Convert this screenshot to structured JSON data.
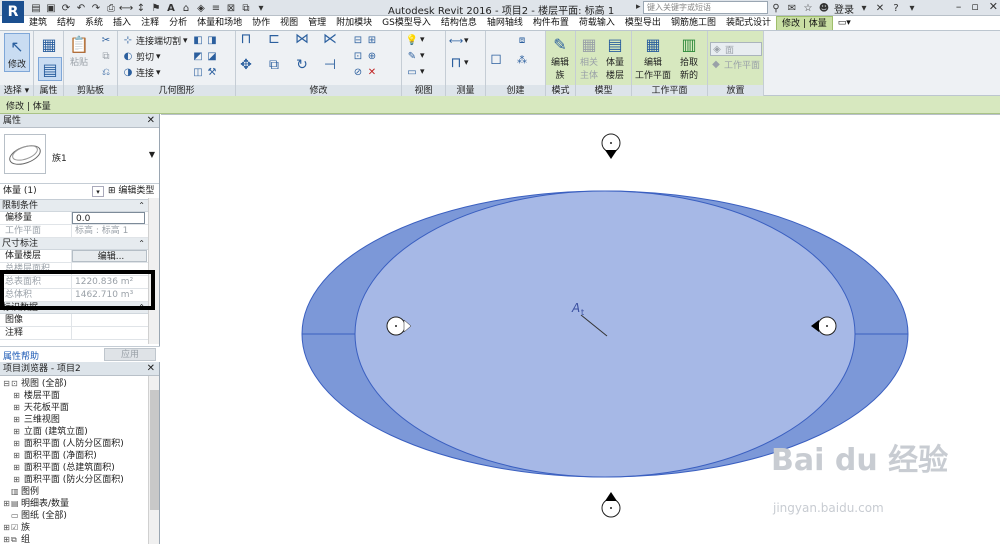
{
  "window": {
    "logo": "R",
    "title": "Autodesk Revit 2016 -     项目2 - 楼层平面: 标高 1",
    "search_placeholder": "键入关键字或短语",
    "login": "登录"
  },
  "ribbon": {
    "tabs": [
      "建筑",
      "结构",
      "系统",
      "插入",
      "注释",
      "分析",
      "体量和场地",
      "协作",
      "视图",
      "管理",
      "附加模块",
      "GS模型导入",
      "结构信息",
      "轴网轴线",
      "构件布置",
      "荷载输入",
      "模型导出",
      "钢筋施工图",
      "装配式设计",
      "修改 | 体量"
    ],
    "active_tab": "修改 | 体量",
    "panels": {
      "select": "选择",
      "properties": "属性",
      "clipboard": "剪贴板",
      "geometry": "几何图形",
      "modify": "修改",
      "view": "视图",
      "measure": "测量",
      "create": "创建",
      "mode": "模式",
      "model": "模型",
      "workplane": "工作平面",
      "placement": "放置"
    },
    "buttons": {
      "modify": "修改",
      "paste": "粘贴",
      "join_cut": "连接端切割",
      "cut": "剪切",
      "join": "连接",
      "edit_family": "编辑\n族",
      "in_place_body": "相关\n主体",
      "mass_floors": "体量\n楼层",
      "edit_workplane": "编辑\n工作平面",
      "pick_new": "拾取\n新的",
      "face": "面",
      "workplane": "工作平面"
    }
  },
  "context_bar": {
    "label": "修改 | 体量"
  },
  "properties": {
    "title": "属性",
    "type_name": "族1",
    "instance_label": "体量 (1)",
    "edit_type": "编辑类型",
    "groups": {
      "constraints": "限制条件",
      "dimensions": "尺寸标注",
      "identity": "标识数据"
    },
    "rows": {
      "offset_key": "偏移量",
      "offset_val": "0.0",
      "workplane_key": "工作平面",
      "workplane_val": "标高 : 标高 1",
      "mass_floors_key": "体量楼层",
      "mass_floors_val": "编辑...",
      "total_floor_area_key": "总楼层面积",
      "total_surface_key": "总表面积",
      "total_surface_val": "1220.836 m²",
      "total_volume_key": "总体积",
      "total_volume_val": "1462.710 m³",
      "image_key": "图像",
      "comments_key": "注释"
    },
    "help": "属性帮助",
    "apply": "应用"
  },
  "browser": {
    "title": "项目浏览器 - 项目2",
    "items": [
      {
        "label": "视图 (全部)",
        "level": 0,
        "exp": "⊟"
      },
      {
        "label": "楼层平面",
        "level": 1,
        "exp": "⊞"
      },
      {
        "label": "天花板平面",
        "level": 1,
        "exp": "⊞"
      },
      {
        "label": "三维视图",
        "level": 1,
        "exp": "⊞"
      },
      {
        "label": "立面 (建筑立面)",
        "level": 1,
        "exp": "⊞"
      },
      {
        "label": "面积平面 (人防分区面积)",
        "level": 1,
        "exp": "⊞"
      },
      {
        "label": "面积平面 (净面积)",
        "level": 1,
        "exp": "⊞"
      },
      {
        "label": "面积平面 (总建筑面积)",
        "level": 1,
        "exp": "⊞"
      },
      {
        "label": "面积平面 (防火分区面积)",
        "level": 1,
        "exp": "⊞"
      },
      {
        "label": "图例",
        "level": 0,
        "exp": ""
      },
      {
        "label": "明细表/数量",
        "level": 0,
        "exp": "⊞"
      },
      {
        "label": "图纸 (全部)",
        "level": 0,
        "exp": ""
      },
      {
        "label": "族",
        "level": 0,
        "exp": "⊞"
      },
      {
        "label": "组",
        "level": 0,
        "exp": "⊞"
      }
    ]
  },
  "colors": {
    "mass_outer": "#7c98d8",
    "mass_inner": "#a6b8e6",
    "mass_stroke": "#3a5fc0",
    "ribbon_green": "#d7e8bf"
  },
  "watermark": {
    "brand": "Bai du 经验",
    "url": "jingyan.baidu.com"
  }
}
